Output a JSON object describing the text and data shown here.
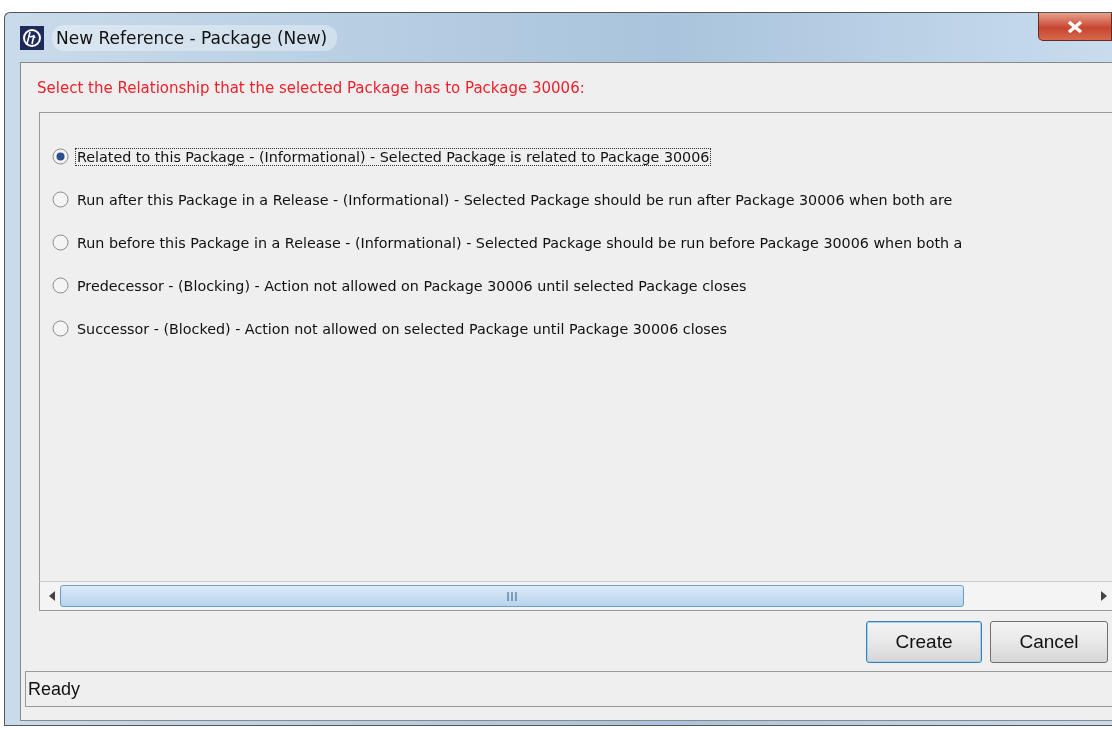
{
  "window": {
    "title": "New Reference - Package (New)"
  },
  "prompt": "Select the Relationship that the selected Package has to Package 30006:",
  "options": [
    {
      "label": "Related to this Package - (Informational) - Selected Package is related to Package 30006",
      "selected": true
    },
    {
      "label": "Run after this Package in a Release - (Informational) - Selected Package should be run after Package 30006 when both are",
      "selected": false
    },
    {
      "label": "Run before this Package in a Release - (Informational) - Selected Package should be run before Package 30006 when both a",
      "selected": false
    },
    {
      "label": "Predecessor - (Blocking) - Action not allowed on Package 30006 until selected Package closes",
      "selected": false
    },
    {
      "label": "Successor - (Blocked) - Action not allowed on selected Package until Package 30006 closes",
      "selected": false
    }
  ],
  "buttons": [
    {
      "label": "Create",
      "kind": "default"
    },
    {
      "label": "Cancel",
      "kind": "normal"
    }
  ],
  "status_bar": "Ready"
}
